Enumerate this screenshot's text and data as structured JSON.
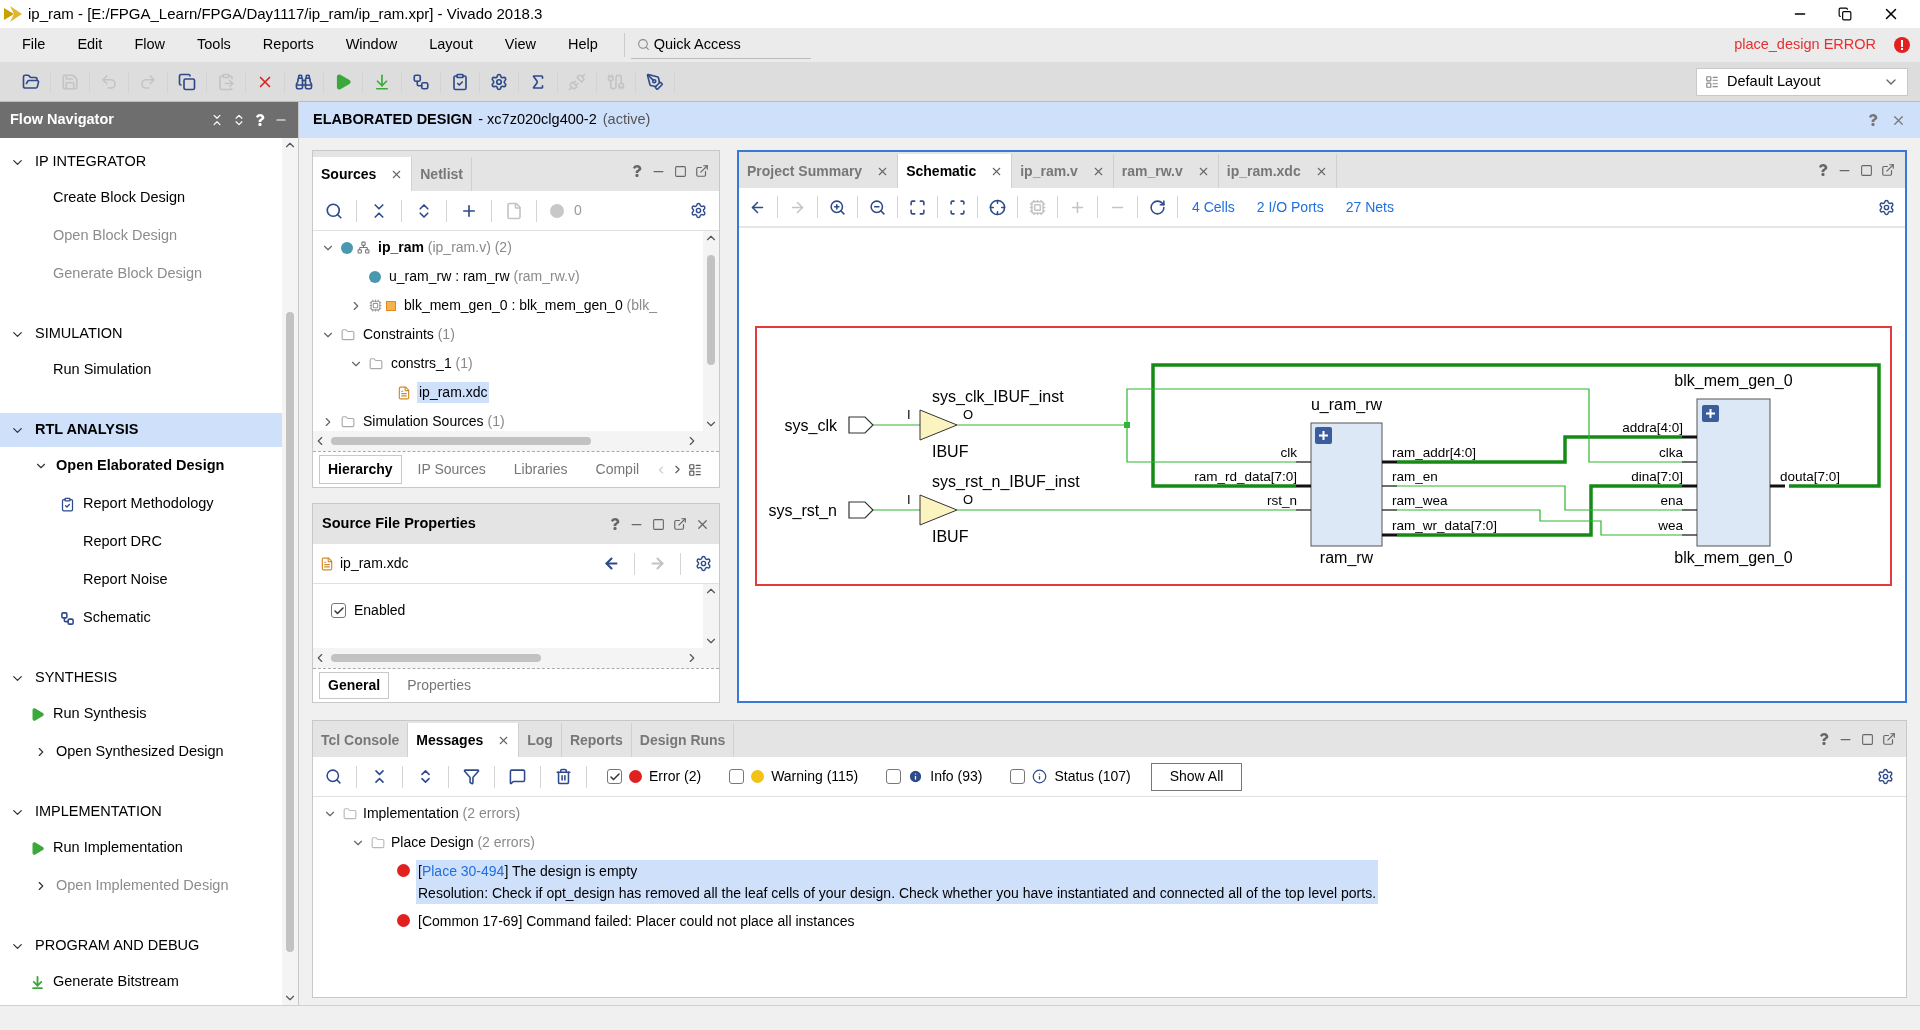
{
  "window": {
    "title": "ip_ram - [E:/FPGA_Learn/FPGA/Day1117/ip_ram/ip_ram.xpr] - Vivado 2018.3"
  },
  "menu": [
    "File",
    "Edit",
    "Flow",
    "Tools",
    "Reports",
    "Window",
    "Layout",
    "View",
    "Help"
  ],
  "quick_access": {
    "placeholder": "Quick Access"
  },
  "run_status": {
    "text": "place_design ERROR"
  },
  "layout_select": {
    "value": "Default Layout"
  },
  "toolbar": [
    {
      "kind": "folder-open",
      "disabled": false
    },
    {
      "kind": "save",
      "disabled": true
    },
    {
      "kind": "undo",
      "disabled": true
    },
    {
      "kind": "redo",
      "disabled": true
    },
    {
      "kind": "copy",
      "disabled": false
    },
    {
      "kind": "paste",
      "disabled": true
    },
    {
      "kind": "close",
      "disabled": false
    },
    {
      "kind": "binoculars",
      "disabled": false
    },
    {
      "kind": "run",
      "disabled": false
    },
    {
      "kind": "bitstream",
      "disabled": false
    },
    {
      "kind": "schematic",
      "disabled": false
    },
    {
      "kind": "clipboard",
      "disabled": false
    },
    {
      "kind": "settings",
      "disabled": false
    },
    {
      "kind": "sigma",
      "disabled": false
    },
    {
      "kind": "unplug",
      "disabled": true
    },
    {
      "kind": "cable",
      "disabled": true
    },
    {
      "kind": "pen",
      "disabled": false
    }
  ],
  "flow_navigator": {
    "title": "Flow Navigator",
    "sections": [
      {
        "title": "IP INTEGRATOR",
        "expanded": true,
        "selected": false,
        "items": [
          {
            "label": "Create Block Design",
            "disabled": false
          },
          {
            "label": "Open Block Design",
            "disabled": true
          },
          {
            "label": "Generate Block Design",
            "disabled": true
          }
        ]
      },
      {
        "title": "SIMULATION",
        "expanded": true,
        "selected": false,
        "items": [
          {
            "label": "Run Simulation",
            "disabled": false
          }
        ]
      },
      {
        "title": "RTL ANALYSIS",
        "expanded": true,
        "selected": true,
        "items": [
          {
            "label": "Open Elaborated Design",
            "disabled": false,
            "active": true,
            "expanded": true,
            "children": [
              {
                "label": "Report Methodology",
                "disabled": false,
                "kind": "report"
              },
              {
                "label": "Report DRC",
                "disabled": false
              },
              {
                "label": "Report Noise",
                "disabled": false
              },
              {
                "label": "Schematic",
                "disabled": false,
                "kind": "schematic"
              }
            ]
          }
        ]
      },
      {
        "title": "SYNTHESIS",
        "expanded": true,
        "selected": false,
        "items": [
          {
            "label": "Run Synthesis",
            "disabled": false,
            "kind": "run"
          },
          {
            "label": "Open Synthesized Design",
            "disabled": false,
            "active": false,
            "expanded": false
          }
        ]
      },
      {
        "title": "IMPLEMENTATION",
        "expanded": true,
        "selected": false,
        "items": [
          {
            "label": "Run Implementation",
            "disabled": false,
            "kind": "run"
          },
          {
            "label": "Open Implemented Design",
            "disabled": true,
            "active": false,
            "expanded": false
          }
        ]
      },
      {
        "title": "PROGRAM AND DEBUG",
        "expanded": true,
        "selected": false,
        "items": [
          {
            "label": "Generate Bitstream",
            "disabled": false,
            "kind": "bitstream"
          }
        ]
      }
    ]
  },
  "banner": {
    "title": "ELABORATED DESIGN",
    "part": "- xc7z020clg400-2",
    "state": "(active)"
  },
  "sources": {
    "tabs": [
      {
        "label": "Sources",
        "selected": true,
        "closable": true
      },
      {
        "label": "Netlist",
        "selected": false,
        "closable": false
      }
    ],
    "toolbar": [
      {
        "kind": "search",
        "disabled": false
      },
      {
        "kind": "collapse",
        "disabled": false
      },
      {
        "kind": "expand",
        "disabled": false
      },
      {
        "kind": "plus",
        "disabled": false
      },
      {
        "kind": "file",
        "disabled": true
      }
    ],
    "error_count": "0",
    "tree": [
      {
        "name": "ip_ram",
        "detail": "(ip_ram.v) (2)",
        "kind": "top",
        "top": true,
        "selected": false,
        "expanded": true,
        "children": [
          {
            "name": "u_ram_rw : ram_rw",
            "detail": "(ram_rw.v)",
            "kind": "module",
            "selected": false
          },
          {
            "name": "blk_mem_gen_0 : blk_mem_gen_0",
            "detail": "(blk_",
            "kind": "ip",
            "selected": false,
            "expanded": false
          }
        ]
      },
      {
        "name": "Constraints",
        "detail": "(1)",
        "kind": "folder",
        "selected": false,
        "expanded": true,
        "children": [
          {
            "name": "constrs_1",
            "detail": "(1)",
            "kind": "folder",
            "selected": false,
            "expanded": true,
            "children": [
              {
                "name": "ip_ram.xdc",
                "kind": "xdc",
                "selected": true
              }
            ]
          }
        ]
      },
      {
        "name": "Simulation Sources",
        "detail": "(1)",
        "kind": "folder",
        "selected": false,
        "expanded": false
      }
    ],
    "bottom_tabs": [
      {
        "label": "Hierarchy",
        "selected": true
      },
      {
        "label": "IP Sources",
        "selected": false
      },
      {
        "label": "Libraries",
        "selected": false
      },
      {
        "label": "Compil",
        "selected": false
      }
    ]
  },
  "properties": {
    "title": "Source File Properties",
    "file": "ip_ram.xdc",
    "enabled": {
      "label": "Enabled",
      "checked": true
    },
    "tabs": [
      {
        "label": "General",
        "selected": true
      },
      {
        "label": "Properties",
        "selected": false
      }
    ]
  },
  "editor": {
    "tabs": [
      {
        "label": "Project Summary",
        "selected": false,
        "closable": true
      },
      {
        "label": "Schematic",
        "selected": true,
        "closable": true
      },
      {
        "label": "ip_ram.v",
        "selected": false,
        "closable": true
      },
      {
        "label": "ram_rw.v",
        "selected": false,
        "closable": true
      },
      {
        "label": "ip_ram.xdc",
        "selected": false,
        "closable": true
      }
    ],
    "toolbar": [
      {
        "kind": "back",
        "disabled": false
      },
      {
        "kind": "forward",
        "disabled": true
      },
      {
        "kind": "zoom-in",
        "disabled": false
      },
      {
        "kind": "zoom-out",
        "disabled": false
      },
      {
        "kind": "fit",
        "disabled": false
      },
      {
        "kind": "zoom-area",
        "disabled": false
      },
      {
        "kind": "crosshair",
        "disabled": false
      },
      {
        "kind": "chip",
        "disabled": true
      },
      {
        "kind": "plus",
        "disabled": true
      },
      {
        "kind": "minus",
        "disabled": true
      },
      {
        "kind": "refresh",
        "disabled": false
      }
    ],
    "stats": [
      "4 Cells",
      "2 I/O Ports",
      "27 Nets"
    ],
    "schematic": {
      "ports": [
        {
          "name": "sys_clk"
        },
        {
          "name": "sys_rst_n"
        }
      ],
      "buffers": [
        {
          "instance": "sys_clk_IBUF_inst",
          "type": "IBUF",
          "input": "I",
          "output": "O"
        },
        {
          "instance": "sys_rst_n_IBUF_inst",
          "type": "IBUF",
          "input": "I",
          "output": "O"
        }
      ],
      "cells": [
        {
          "instance": "u_ram_rw",
          "type": "ram_rw",
          "left_pins": [
            {
              "name": "clk",
              "bus": false
            },
            {
              "name": "ram_rd_data[7:0]",
              "bus": true
            },
            {
              "name": "rst_n",
              "bus": false
            }
          ],
          "right_pins": [
            {
              "name": "ram_addr[4:0]",
              "bus": true
            },
            {
              "name": "ram_en",
              "bus": false
            },
            {
              "name": "ram_wea",
              "bus": false
            },
            {
              "name": "ram_wr_data[7:0]",
              "bus": true
            }
          ]
        },
        {
          "instance": "blk_mem_gen_0",
          "type": "blk_mem_gen_0",
          "left_pins": [
            {
              "name": "addra[4:0]",
              "bus": true
            },
            {
              "name": "clka",
              "bus": false
            },
            {
              "name": "dina[7:0]",
              "bus": true
            },
            {
              "name": "ena",
              "bus": false
            },
            {
              "name": "wea",
              "bus": false
            }
          ],
          "right_pins": [
            {
              "name": "douta[7:0]",
              "bus": true
            }
          ]
        }
      ]
    }
  },
  "messages": {
    "tabs": [
      {
        "label": "Tcl Console",
        "selected": false,
        "closable": false
      },
      {
        "label": "Messages",
        "selected": true,
        "closable": true
      },
      {
        "label": "Log",
        "selected": false,
        "closable": false
      },
      {
        "label": "Reports",
        "selected": false,
        "closable": false
      },
      {
        "label": "Design Runs",
        "selected": false,
        "closable": false
      }
    ],
    "toolbar": [
      {
        "kind": "search",
        "disabled": false
      },
      {
        "kind": "collapse",
        "disabled": false
      },
      {
        "kind": "expand",
        "disabled": false
      },
      {
        "kind": "filter",
        "disabled": false
      },
      {
        "kind": "message",
        "disabled": false
      },
      {
        "kind": "trash",
        "disabled": false
      }
    ],
    "filters": [
      {
        "kind": "error",
        "label": "Error (2)",
        "checked": true
      },
      {
        "kind": "warning",
        "label": "Warning (115)",
        "checked": false
      },
      {
        "kind": "info",
        "label": "Info (93)",
        "checked": false
      },
      {
        "kind": "status",
        "label": "Status (107)",
        "checked": false
      }
    ],
    "show_all": "Show All",
    "tree": [
      {
        "label": "Implementation",
        "detail": "(2 errors)",
        "expanded": true,
        "children": [
          {
            "label": "Place Design",
            "detail": "(2 errors)",
            "expanded": true,
            "children": [
              {
                "open": "[",
                "link": "Place 30-494",
                "text": "] The design is empty",
                "resolution": "Resolution: Check if opt_design has removed all the leaf cells of your design. Check whether you have instantiated and connected all of the top level ports.",
                "selected": true
              },
              {
                "text": "[Common 17-69] Command failed: Placer could not place all instances",
                "selected": false
              }
            ]
          }
        ]
      }
    ]
  }
}
